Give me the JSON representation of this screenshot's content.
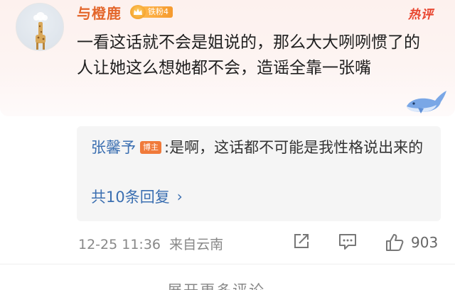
{
  "comment": {
    "username": "与橙鹿",
    "fan_badge": "铁粉4",
    "hot_tag": "热评",
    "text": "一看这话就不会是姐说的，那么大大咧咧惯了的人让她这么想她都不会，造谣全靠一张嘴"
  },
  "reply": {
    "author": "张馨予",
    "author_tag": "博主",
    "separator": ":",
    "text": "是啊，这话都不可能是我性格说出来的",
    "more_label": "共10条回复",
    "more_chevron": "›"
  },
  "footer": {
    "timestamp": "12-25 11:36",
    "location": "来自云南",
    "like_count": "903",
    "icons": [
      "share-icon",
      "comment-icon",
      "like-icon"
    ]
  },
  "expand": {
    "label": "展开更多评论",
    "chevron": "⌄"
  },
  "colors": {
    "username": "#e3652a",
    "hot": "#e8432d",
    "link": "#3b6fb1",
    "muted": "#888888"
  }
}
